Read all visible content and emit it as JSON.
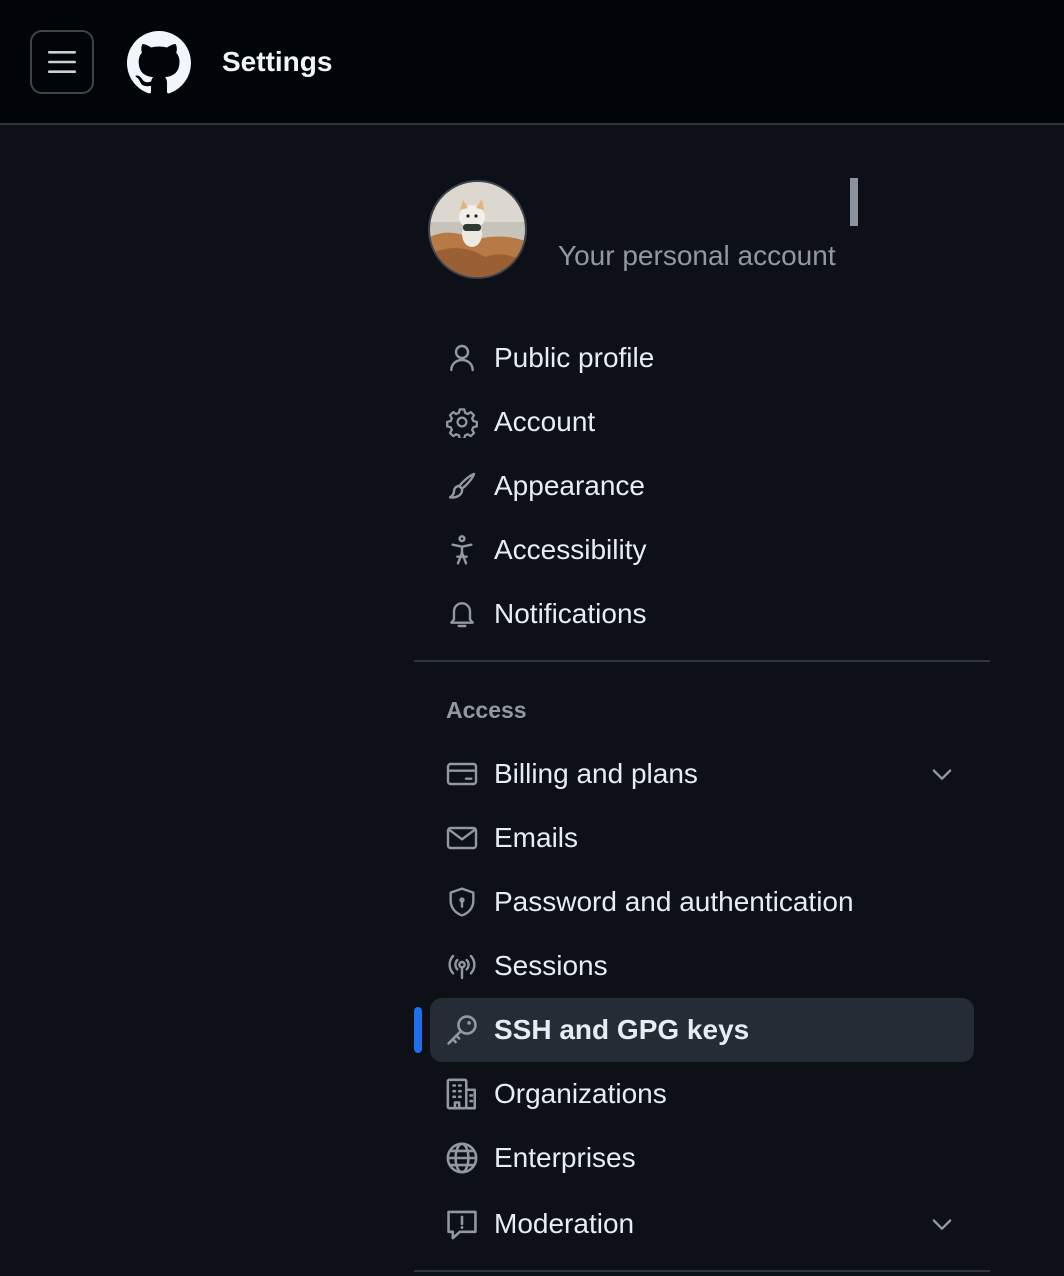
{
  "header": {
    "title": "Settings",
    "menu_icon": "hamburger-icon",
    "logo_icon": "github-logo-icon"
  },
  "profile": {
    "subtitle": "Your personal account",
    "avatar": "avatar-image"
  },
  "sections": {
    "access_label": "Access"
  },
  "nav": {
    "public_profile": "Public profile",
    "account": "Account",
    "appearance": "Appearance",
    "accessibility": "Accessibility",
    "notifications": "Notifications",
    "billing": "Billing and plans",
    "emails": "Emails",
    "password": "Password and authentication",
    "sessions": "Sessions",
    "ssh": "SSH and GPG keys",
    "organizations": "Organizations",
    "enterprises": "Enterprises",
    "moderation": "Moderation"
  },
  "colors": {
    "background": "#0d1117",
    "header_bg": "#010409",
    "active_accent": "#1f6feb",
    "active_bg": "#262c36",
    "muted_text": "#9198a1"
  }
}
